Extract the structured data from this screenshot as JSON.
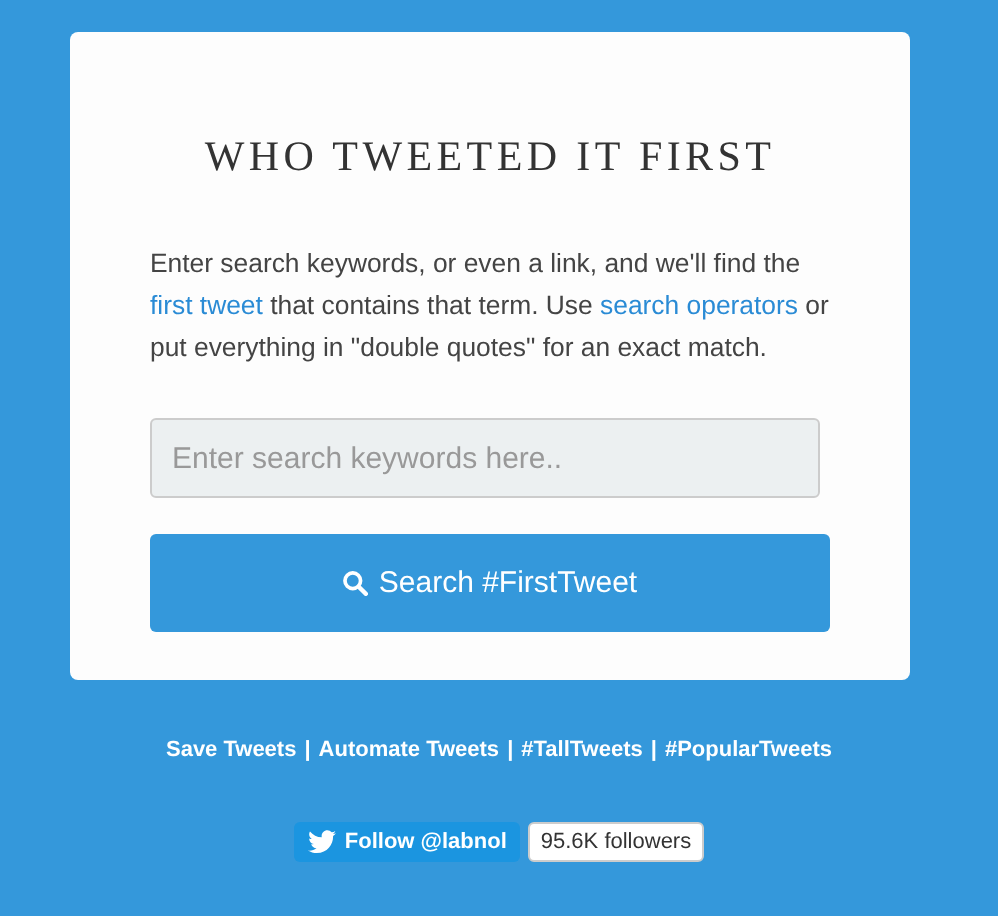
{
  "card": {
    "title": "WHO TWEETED IT FIRST",
    "description": [
      {
        "kind": "text",
        "text": "Enter search keywords, or even a link, and we'll find the "
      },
      {
        "kind": "link",
        "text": "first tweet"
      },
      {
        "kind": "text",
        "text": " that contains that term. Use "
      },
      {
        "kind": "link",
        "text": "search operators"
      },
      {
        "kind": "text",
        "text": " or put everything in \"double quotes\" for an exact match."
      }
    ],
    "search": {
      "placeholder": "Enter search keywords here.."
    },
    "button": "Search #FirstTweet"
  },
  "footer": {
    "separator": "|",
    "links": [
      "Save Tweets",
      "Automate Tweets",
      "#TallTweets",
      "#PopularTweets"
    ]
  },
  "follow": {
    "button": "Follow @labnol",
    "count": "95.6K followers"
  }
}
